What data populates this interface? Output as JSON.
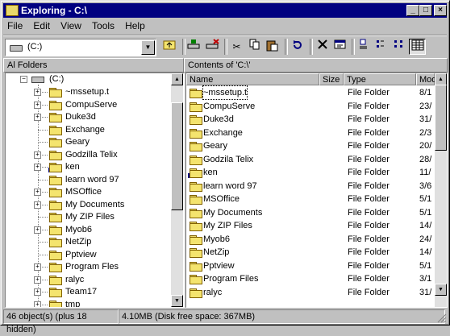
{
  "window": {
    "title": "Exploring - C:\\"
  },
  "title_buttons": {
    "minimize": "_",
    "maximize": "□",
    "close": "×"
  },
  "menu": [
    {
      "label": "File"
    },
    {
      "label": "Edit"
    },
    {
      "label": "View"
    },
    {
      "label": "Tools"
    },
    {
      "label": "Help"
    }
  ],
  "address": {
    "value": "(C:)"
  },
  "toolbar_icons": [
    "up-one-level-icon",
    "map-network-drive-icon",
    "disconnect-drive-icon",
    "cut-icon",
    "copy-icon",
    "paste-icon",
    "undo-icon",
    "delete-icon",
    "properties-icon",
    "large-icons-icon",
    "small-icons-icon",
    "list-icon",
    "details-icon"
  ],
  "panes": {
    "left_header": "Al Folders",
    "right_header": "Contents of 'C:\\'"
  },
  "tree": {
    "root": "(C:)",
    "items": [
      {
        "label": "~mssetup.t",
        "expander": "+"
      },
      {
        "label": "CompuServe",
        "expander": "+"
      },
      {
        "label": "Duke3d",
        "expander": "+"
      },
      {
        "label": "Exchange",
        "expander": ""
      },
      {
        "label": "Geary",
        "expander": ""
      },
      {
        "label": "Godzilla Telix",
        "expander": "+"
      },
      {
        "label": "ken",
        "expander": "+"
      },
      {
        "label": "learn word 97",
        "expander": ""
      },
      {
        "label": "MSOffice",
        "expander": "+"
      },
      {
        "label": "My Documents",
        "expander": "+"
      },
      {
        "label": "My ZIP Files",
        "expander": ""
      },
      {
        "label": "Myob6",
        "expander": "+"
      },
      {
        "label": "NetZip",
        "expander": ""
      },
      {
        "label": "Pptview",
        "expander": ""
      },
      {
        "label": "Program Fles",
        "expander": "+"
      },
      {
        "label": "ralyc",
        "expander": "+"
      },
      {
        "label": "Team17",
        "expander": "+"
      },
      {
        "label": "tmp",
        "expander": "+"
      }
    ]
  },
  "columns": {
    "name": "Name",
    "size": "Size",
    "type": "Type",
    "modified": "Mod"
  },
  "files": [
    {
      "name": "~mssetup.t",
      "type": "File Folder",
      "mod": "8/1"
    },
    {
      "name": "CompuServe",
      "type": "File Folder",
      "mod": "23/"
    },
    {
      "name": "Duke3d",
      "type": "File Folder",
      "mod": "31/"
    },
    {
      "name": "Exchange",
      "type": "File Folder",
      "mod": "2/3"
    },
    {
      "name": "Geary",
      "type": "File Folder",
      "mod": "20/"
    },
    {
      "name": "Godzila Telix",
      "type": "File Folder",
      "mod": "28/"
    },
    {
      "name": "ken",
      "type": "File Folder",
      "mod": "11/"
    },
    {
      "name": "learn word 97",
      "type": "File Folder",
      "mod": "3/6"
    },
    {
      "name": "MSOffice",
      "type": "File Folder",
      "mod": "5/1"
    },
    {
      "name": "My Documents",
      "type": "File Folder",
      "mod": "5/1"
    },
    {
      "name": "My ZIP Files",
      "type": "File Folder",
      "mod": "14/"
    },
    {
      "name": "Myob6",
      "type": "File Folder",
      "mod": "24/"
    },
    {
      "name": "NetZip",
      "type": "File Folder",
      "mod": "14/"
    },
    {
      "name": "Pptview",
      "type": "File Folder",
      "mod": "5/1"
    },
    {
      "name": "Program Files",
      "type": "File Folder",
      "mod": "3/1"
    },
    {
      "name": "ralyc",
      "type": "File Folder",
      "mod": "31/"
    }
  ],
  "status": {
    "objects": "46 object(s) (plus 18 hidden)",
    "size": "4.10MB (Disk free space: 367MB)"
  },
  "colors": {
    "titlebar": "#000080",
    "face": "#c0c0c0",
    "folder": "#f4e46e"
  }
}
